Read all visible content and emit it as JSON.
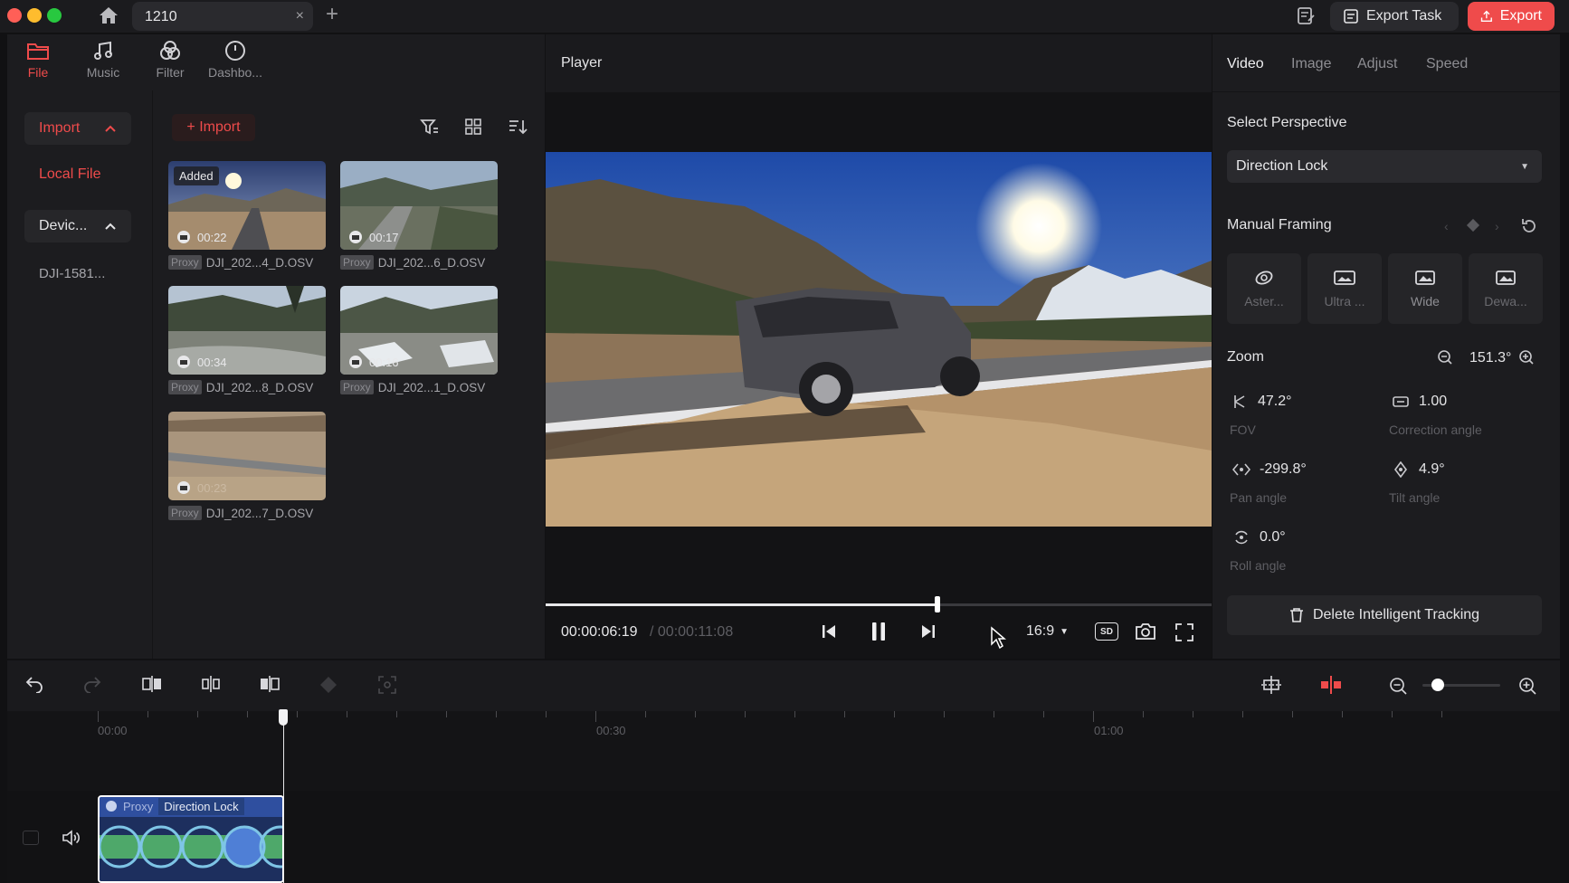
{
  "titlebar": {
    "tab_title": "1210",
    "tab_close": "×",
    "new_tab": "+",
    "export_task_label": "Export Task",
    "export_label": "Export"
  },
  "nav": {
    "items": [
      {
        "label": "File",
        "icon": "folder-icon",
        "active": true
      },
      {
        "label": "Music",
        "icon": "music-note-icon",
        "active": false
      },
      {
        "label": "Filter",
        "icon": "filter-circles-icon",
        "active": false
      },
      {
        "label": "Dashbo...",
        "icon": "dashboard-gauge-icon",
        "active": false
      }
    ]
  },
  "sidebar": {
    "import_label": "Import",
    "local_file_label": "Local File",
    "device_label": "Devic...",
    "device_item": "DJI-1581..."
  },
  "media": {
    "import_button": "+ Import",
    "added_badge": "Added",
    "proxy_tag": "Proxy",
    "clips": [
      {
        "duration": "00:22",
        "name": "DJI_202...4_D.OSV"
      },
      {
        "duration": "00:17",
        "name": "DJI_202...6_D.OSV"
      },
      {
        "duration": "00:34",
        "name": "DJI_202...8_D.OSV"
      },
      {
        "duration": "00:16",
        "name": "DJI_202...1_D.OSV"
      },
      {
        "duration": "00:23",
        "name": "DJI_202...7_D.OSV"
      }
    ]
  },
  "player": {
    "title": "Player",
    "current_time": "00:00:06:19",
    "total_time": "/ 00:00:11:08",
    "progress": 0.588,
    "aspect": "16:9",
    "quality": "SD"
  },
  "inspector": {
    "tabs": [
      "Video",
      "Image",
      "Adjust",
      "Speed"
    ],
    "select_perspective_label": "Select Perspective",
    "perspective_value": "Direction Lock",
    "manual_framing_label": "Manual Framing",
    "framing_modes": [
      {
        "label": "Aster...",
        "icon": "asteroid-icon"
      },
      {
        "label": "Ultra ...",
        "icon": "ultra-wide-icon"
      },
      {
        "label": "Wide",
        "icon": "wide-icon"
      },
      {
        "label": "Dewa...",
        "icon": "dewarp-icon"
      }
    ],
    "zoom_label": "Zoom",
    "zoom_value": "151.3°",
    "fov_value": "47.2°",
    "fov_label": "FOV",
    "correction_value": "1.00",
    "correction_label": "Correction angle",
    "pan_value": "-299.8°",
    "pan_label": "Pan angle",
    "tilt_value": "4.9°",
    "tilt_label": "Tilt angle",
    "roll_value": "0.0°",
    "roll_label": "Roll angle",
    "delete_tracking_label": "Delete Intelligent Tracking"
  },
  "timeline": {
    "ticks": [
      "00:00",
      "00:30",
      "01:00"
    ],
    "clip_proxy": "Proxy",
    "clip_label": "Direction Lock",
    "playhead_fraction": 0.186,
    "zoom_fraction": 0.2
  },
  "colors": {
    "accent": "#ef4b4b",
    "panel": "#1c1c1f",
    "clip_blue": "#2f4f9f"
  }
}
